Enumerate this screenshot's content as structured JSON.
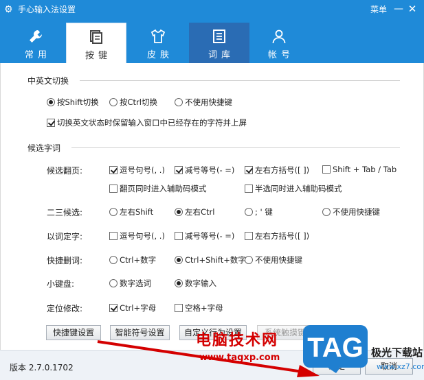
{
  "window": {
    "title": "手心输入法设置",
    "menu_label": "菜单",
    "minimize_icon": "minimize-icon",
    "close_icon": "close-icon"
  },
  "tabs": [
    {
      "label": "常用",
      "icon": "wrench-icon",
      "state": "normal"
    },
    {
      "label": "按键",
      "icon": "keyboard-icon",
      "state": "active"
    },
    {
      "label": "皮肤",
      "icon": "shirt-icon",
      "state": "normal"
    },
    {
      "label": "词库",
      "icon": "document-icon",
      "state": "highlighted"
    },
    {
      "label": "帐号",
      "icon": "user-icon",
      "state": "normal"
    }
  ],
  "zh_en_switch": {
    "title": "中英文切换",
    "options": [
      {
        "label": "按Shift切换",
        "checked": true
      },
      {
        "label": "按Ctrl切换",
        "checked": false
      },
      {
        "label": "不使用快捷键",
        "checked": false
      }
    ],
    "keep_chars": {
      "label": "切换英文状态时保留输入窗口中已经存在的字符并上屏",
      "checked": true
    }
  },
  "candidates": {
    "title": "候选字词",
    "page_turn": {
      "label": "候选翻页:",
      "options": [
        {
          "label": "逗号句号(, .)",
          "checked": true
        },
        {
          "label": "减号等号(- =)",
          "checked": true
        },
        {
          "label": "左右方括号([ ])",
          "checked": true
        },
        {
          "label": "Shift + Tab / Tab",
          "checked": false
        },
        {
          "label": "翻页同时进入辅助码模式",
          "checked": false
        },
        {
          "label": "半选同时进入辅助码模式",
          "checked": false
        }
      ]
    },
    "second_candidate": {
      "label": "二三候选:",
      "options": [
        {
          "label": "左右Shift",
          "checked": false
        },
        {
          "label": "左右Ctrl",
          "checked": true
        },
        {
          "label": "; ' 键",
          "checked": false
        },
        {
          "label": "不使用快捷键",
          "checked": false
        }
      ]
    },
    "word_to_char": {
      "label": "以词定字:",
      "options": [
        {
          "label": "逗号句号(, .)",
          "checked": false
        },
        {
          "label": "减号等号(- =)",
          "checked": false
        },
        {
          "label": "左右方括号([ ])",
          "checked": false
        }
      ]
    },
    "quick_delete": {
      "label": "快捷删词:",
      "options": [
        {
          "label": "Ctrl+数字",
          "checked": false
        },
        {
          "label": "Ctrl+Shift+数字",
          "checked": true
        },
        {
          "label": "不使用快捷键",
          "checked": false
        }
      ]
    },
    "keypad": {
      "label": "小键盘:",
      "options": [
        {
          "label": "数字选词",
          "checked": false
        },
        {
          "label": "数字输入",
          "checked": true
        }
      ]
    },
    "locate_edit": {
      "label": "定位修改:",
      "options": [
        {
          "label": "Ctrl+字母",
          "checked": true
        },
        {
          "label": "空格+字母",
          "checked": false
        }
      ]
    }
  },
  "action_buttons": [
    {
      "label": "快捷键设置"
    },
    {
      "label": "智能符号设置"
    },
    {
      "label": "自定义行为设置"
    },
    {
      "label": "系统触摸键盘布局设置"
    }
  ],
  "footer": {
    "version": "版本 2.7.0.1702",
    "ok_label": "确定",
    "cancel_label": "取消"
  },
  "watermark": {
    "text": "电脑技术网",
    "url": "www.tagxp.com",
    "badge": "TAG",
    "side_text": "极光下载站",
    "side_url": "www.xz7.com"
  }
}
